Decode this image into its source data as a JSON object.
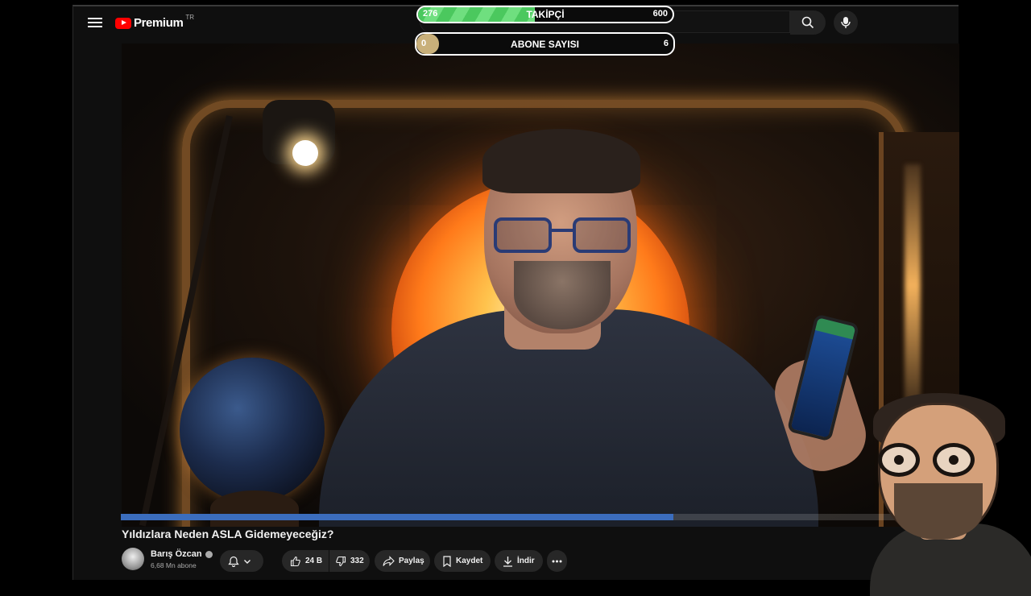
{
  "header": {
    "logo_text": "Premium",
    "region": "TR",
    "menu_icon": "hamburger-menu-icon",
    "search_icon": "search-icon",
    "mic_icon": "microphone-icon"
  },
  "overlay": {
    "followers": {
      "label": "TAKİPÇİ",
      "current": "276",
      "goal": "600",
      "progress": 0.46,
      "color": "#4bc85e"
    },
    "subscribers": {
      "label": "ABONE SAYISI",
      "current": "0",
      "goal": "6",
      "progress": 0.0,
      "color": "#c9b07a"
    }
  },
  "video": {
    "title": "Yıldızlara Neden ASLA Gidemeyeceğiz?",
    "progress": 0.66,
    "progress_color": "#3b6dbd"
  },
  "channel": {
    "name": "Barış Özcan",
    "subscribers": "6,68 Mn abone",
    "verified_icon": "verified-check-icon"
  },
  "actions": {
    "bell_icon": "bell-icon",
    "chevron_icon": "chevron-down-icon",
    "likes": "24 B",
    "dislikes": "332",
    "share": "Paylaş",
    "save": "Kaydet",
    "download": "İndir",
    "more_icon": "more-horizontal-icon"
  },
  "colors": {
    "background": "#0f0f0f",
    "pill": "#272727",
    "brand_red": "#ff0000"
  }
}
